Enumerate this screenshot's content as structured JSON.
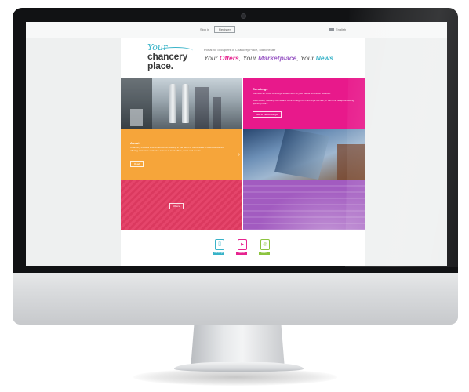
{
  "topbar": {
    "signin_label": "Sign in",
    "signin_button": "Register",
    "language_label": "English"
  },
  "logo": {
    "your": "Your",
    "line1": "chancery",
    "line2": "place."
  },
  "header": {
    "small_text": "Portal for occupiers of Chancery Place, Manchester",
    "tagline_prefix": "Your ",
    "tagline_offers": "Offers",
    "tagline_mid1": ", Your ",
    "tagline_market": "Marketplace",
    "tagline_mid2": ", Your ",
    "tagline_news": "News"
  },
  "tiles": {
    "concierge": {
      "title": "Concierge",
      "text1": "We have an office concierge to deal with all your needs whenever possible.",
      "text2": "Book desks, meeting rooms and more through the concierge service, or call in at reception during opening hours.",
      "button": "Get to the concierge"
    },
    "about": {
      "title": "About",
      "text": "Chancery Place is a landmark office building in the heart of Manchester's business district, offering occupiers exclusive access to local offers, news and events.",
      "button": "Read"
    },
    "offers": {
      "button": "Offers"
    }
  },
  "bottom_icons": [
    {
      "icon": "phone-icon",
      "label": "Concierge",
      "color": "#38b3c8"
    },
    {
      "icon": "video-icon",
      "label": "Videos",
      "color": "#e6248f"
    },
    {
      "icon": "camera-icon",
      "label": "Gallery",
      "color": "#8cc43f"
    }
  ],
  "colors": {
    "pink": "#e8198b",
    "orange": "#f6a53a",
    "red": "#e43b63",
    "purple": "#a25bc0",
    "teal": "#38b3c8"
  }
}
